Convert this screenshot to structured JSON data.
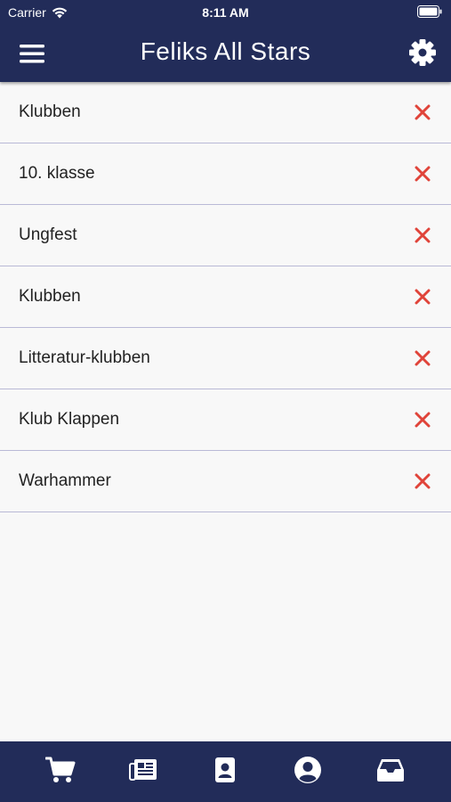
{
  "status_bar": {
    "carrier": "Carrier",
    "time": "8:11 AM"
  },
  "header": {
    "title": "Feliks All Stars",
    "menu_icon": "hamburger-menu-icon",
    "settings_icon": "gear-icon"
  },
  "clubs": [
    {
      "name": "Klubben"
    },
    {
      "name": "10. klasse"
    },
    {
      "name": "Ungfest"
    },
    {
      "name": "Klubben"
    },
    {
      "name": "Litteratur-klubben"
    },
    {
      "name": "Klub Klappen"
    },
    {
      "name": "Warhammer"
    }
  ],
  "tab_bar": {
    "tabs": [
      "cart-icon",
      "newspaper-icon",
      "contact-card-icon",
      "user-circle-icon",
      "inbox-icon"
    ]
  },
  "colors": {
    "primary": "#222c59",
    "remove": "#e0443a",
    "background": "#f8f8f8",
    "divider": "#b9b9d6"
  }
}
